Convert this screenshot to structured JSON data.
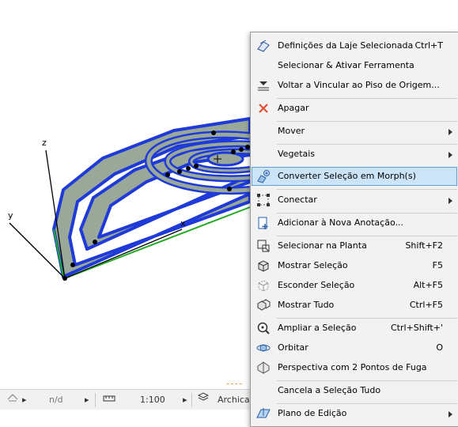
{
  "status_bar": {
    "layer_value": "n/d",
    "scale": "1:100",
    "layer_name": "Archicad"
  },
  "context_menu": {
    "items": [
      {
        "label": "Definições da Laje Selecionada",
        "shortcut": "Ctrl+T",
        "icon": "slab-settings-icon"
      },
      {
        "label": "Selecionar & Ativar Ferramenta",
        "shortcut": "",
        "icon": ""
      },
      {
        "label": "Voltar a Vincular ao Piso de Origem...",
        "shortcut": "",
        "icon": "relink-floor-icon"
      },
      {
        "label": "Apagar",
        "shortcut": "",
        "icon": "delete-icon"
      },
      {
        "label": "Mover",
        "shortcut": "",
        "icon": "",
        "submenu": true
      },
      {
        "label": "Vegetais",
        "shortcut": "",
        "icon": "",
        "submenu": true
      },
      {
        "label": "Converter Seleção em Morph(s)",
        "shortcut": "",
        "icon": "convert-morph-icon",
        "highlighted": true
      },
      {
        "label": "Conectar",
        "shortcut": "",
        "icon": "connect-icon",
        "submenu": true
      },
      {
        "label": "Adicionar à Nova Anotação...",
        "shortcut": "",
        "icon": "add-annotation-icon"
      },
      {
        "label": "Selecionar na Planta",
        "shortcut": "Shift+F2",
        "icon": "select-in-plan-icon"
      },
      {
        "label": "Mostrar Seleção",
        "shortcut": "F5",
        "icon": "show-selection-icon"
      },
      {
        "label": "Esconder Seleção",
        "shortcut": "Alt+F5",
        "icon": "hide-selection-icon"
      },
      {
        "label": "Mostrar Tudo",
        "shortcut": "Ctrl+F5",
        "icon": "show-all-icon"
      },
      {
        "label": "Ampliar a Seleção",
        "shortcut": "Ctrl+Shift+'",
        "icon": "zoom-selection-icon"
      },
      {
        "label": "Orbitar",
        "shortcut": "O",
        "icon": "orbit-icon"
      },
      {
        "label": "Perspectiva com 2 Pontos de Fuga",
        "shortcut": "",
        "icon": "two-point-perspective-icon"
      },
      {
        "label": "Cancela a Seleção Tudo",
        "shortcut": "",
        "icon": ""
      },
      {
        "label": "Plano de Edição",
        "shortcut": "",
        "icon": "edit-plane-icon",
        "submenu": true
      }
    ]
  },
  "axes": {
    "x": "x",
    "y": "y",
    "z": "z"
  },
  "colors": {
    "highlight": "#cce4f7",
    "slab_fill": "#9aa89a",
    "slab_edge": "#1e3ad8",
    "axis_green": "#22aa22"
  }
}
